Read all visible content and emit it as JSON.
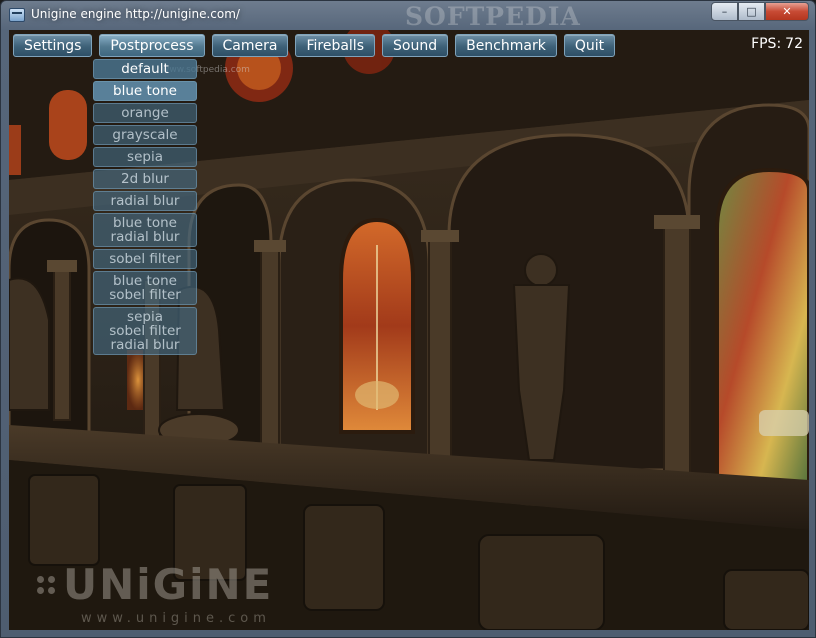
{
  "window": {
    "title": "Unigine engine http://unigine.com/",
    "watermark": "SOFTPEDIA",
    "controls": {
      "minimize": "–",
      "maximize": "□",
      "close": "✕"
    }
  },
  "menu": {
    "items": [
      "Settings",
      "Postprocess",
      "Camera",
      "Fireballs",
      "Sound",
      "Benchmark",
      "Quit"
    ],
    "active": "Postprocess"
  },
  "fps": {
    "label": "FPS:",
    "value": "72"
  },
  "postprocess_dropdown": {
    "options": [
      {
        "lines": [
          "default"
        ]
      },
      {
        "lines": [
          "blue tone"
        ]
      },
      {
        "lines": [
          "orange"
        ]
      },
      {
        "lines": [
          "grayscale"
        ]
      },
      {
        "lines": [
          "sepia"
        ]
      },
      {
        "lines": [
          "2d blur"
        ]
      },
      {
        "lines": [
          "radial blur"
        ]
      },
      {
        "lines": [
          "blue tone",
          "radial blur"
        ]
      },
      {
        "lines": [
          "sobel filter"
        ]
      },
      {
        "lines": [
          "blue tone",
          "sobel filter"
        ]
      },
      {
        "lines": [
          "sepia",
          "sobel filter",
          "radial blur"
        ]
      }
    ],
    "selected": "default",
    "hovered": "blue tone"
  },
  "overlay": {
    "softpedia_small": "www.softpedia.com",
    "logo_text": "UNiGiNE",
    "logo_url": "www.unigine.com"
  },
  "scene": {
    "description_colors": {
      "stone": "#3a2d1f",
      "glass_warm": "#c8581e",
      "glass_green": "#5b7a3a"
    }
  }
}
